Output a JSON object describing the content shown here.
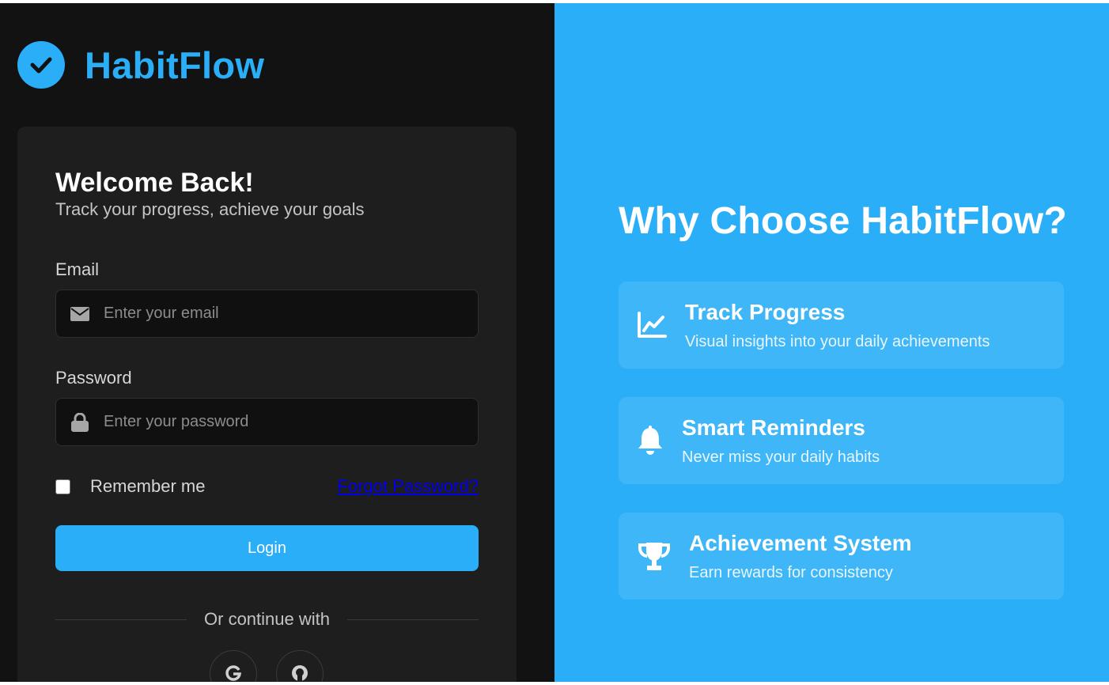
{
  "brand": {
    "name": "HabitFlow",
    "icon": "check-circle-icon",
    "accent_color": "#29aef7"
  },
  "login": {
    "title": "Welcome Back!",
    "subtitle": "Track your progress, achieve your goals",
    "email": {
      "label": "Email",
      "placeholder": "Enter your email",
      "icon": "envelope-icon"
    },
    "password": {
      "label": "Password",
      "placeholder": "Enter your password",
      "icon": "lock-icon"
    },
    "remember_label": "Remember me",
    "forgot_label": "Forgot Password?",
    "login_label": "Login",
    "divider_label": "Or continue with",
    "social": [
      {
        "name": "google",
        "icon": "google-icon"
      },
      {
        "name": "github",
        "icon": "github-icon"
      }
    ]
  },
  "features": {
    "title": "Why Choose HabitFlow?",
    "items": [
      {
        "icon": "chart-line-icon",
        "title": "Track Progress",
        "description": "Visual insights into your daily achievements"
      },
      {
        "icon": "bell-icon",
        "title": "Smart Reminders",
        "description": "Never miss your daily habits"
      },
      {
        "icon": "trophy-icon",
        "title": "Achievement System",
        "description": "Earn rewards for consistency"
      }
    ]
  },
  "colors": {
    "left_bg": "#121212",
    "card_bg": "#1e1e1e",
    "right_bg": "#29aef7"
  }
}
